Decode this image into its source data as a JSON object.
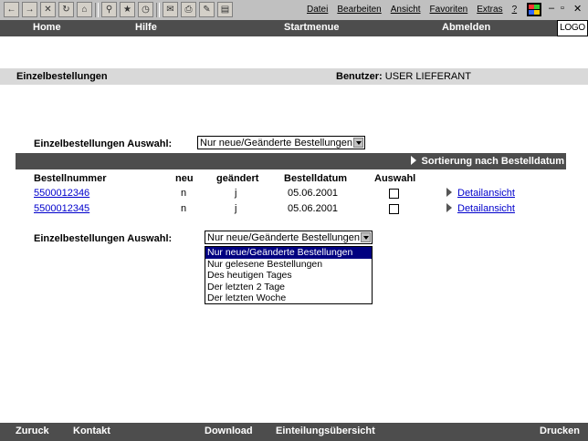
{
  "browser": {
    "menu": [
      "Datei",
      "Bearbeiten",
      "Ansicht",
      "Favoriten",
      "Extras",
      "?"
    ],
    "icons": [
      "back-icon",
      "forward-icon",
      "stop-icon",
      "refresh-icon",
      "home-icon",
      "search-icon",
      "favorites-icon",
      "history-icon",
      "mail-icon",
      "print-icon",
      "edit-icon",
      "discuss-icon"
    ]
  },
  "topnav": {
    "home": "Home",
    "help": "Hilfe",
    "start": "Startmenue",
    "logout": "Abmelden",
    "logo": "LOGO"
  },
  "title": {
    "text": "Einzelbestellungen",
    "user_label": "Benutzer:",
    "user_value": "USER LIEFERANT"
  },
  "selection": {
    "label": "Einzelbestellungen Auswahl:",
    "value": "Nur neue/Geänderte Bestellungen",
    "options": [
      "Nur neue/Geänderte Bestellungen",
      "Nur gelesene Bestellungen",
      "Des heutigen Tages",
      "Der letzten 2 Tage",
      "Der letzten Woche"
    ]
  },
  "sort_label": "Sortierung nach Bestelldatum",
  "table": {
    "headers": {
      "number": "Bestellnummer",
      "new": "neu",
      "changed": "geändert",
      "date": "Bestelldatum",
      "select": "Auswahl"
    },
    "rows": [
      {
        "number": "5500012346",
        "new": "n",
        "changed": "j",
        "date": "05.06.2001",
        "detail": "Detailansicht"
      },
      {
        "number": "5500012345",
        "new": "n",
        "changed": "j",
        "date": "05.06.2001",
        "detail": "Detailansicht"
      }
    ]
  },
  "bottomnav": {
    "back": "Zuruck",
    "contact": "Kontakt",
    "download": "Download",
    "overview": "Einteilungsübersicht",
    "print": "Drucken"
  },
  "colors": {
    "nav": "#4d4d4d",
    "titlebar": "#d9d9d9",
    "link": "#0000cc",
    "highlight": "#000080"
  }
}
